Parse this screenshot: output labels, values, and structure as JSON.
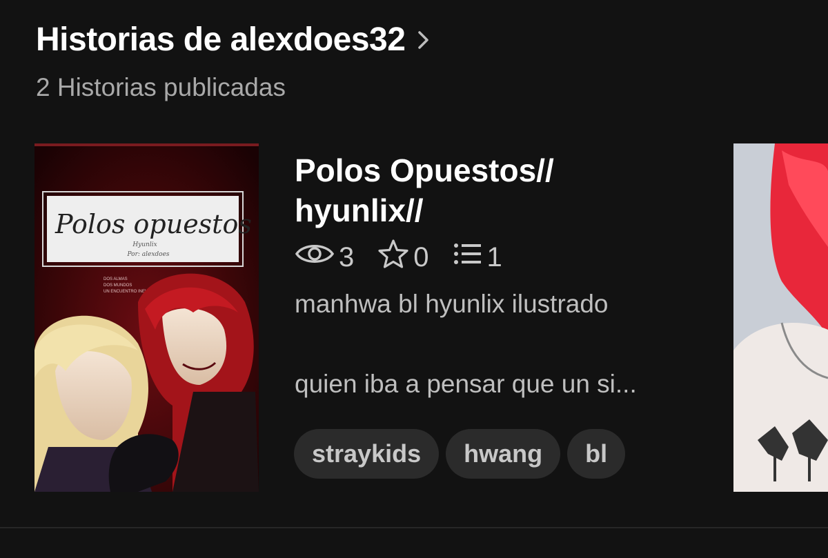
{
  "header": {
    "title": "Historias de alexdoes32",
    "subtitle": "2 Historias publicadas"
  },
  "stories": [
    {
      "title_line1": "Polos Opuestos//",
      "title_line2": "hyunlix//",
      "cover": {
        "title_text": "Polos opuestos",
        "caption_lines": [
          "Hyunlix",
          "Por: alexdoes"
        ],
        "tagline_lines": [
          "DOS ALMAS",
          "DOS MUNDOS",
          "UN ENCUENTRO INEVITABLE"
        ]
      },
      "stats": {
        "reads": "3",
        "votes": "0",
        "parts": "1"
      },
      "description_line1": "manhwa bl hyunlix ilustrado",
      "description_line2": "quien iba a pensar que un si...",
      "tags": [
        "straykids",
        "hwang",
        "bl"
      ]
    }
  ],
  "colors": {
    "background": "#121212",
    "tag_bg": "#2b2b2b",
    "muted_text": "#a9a9a9"
  }
}
